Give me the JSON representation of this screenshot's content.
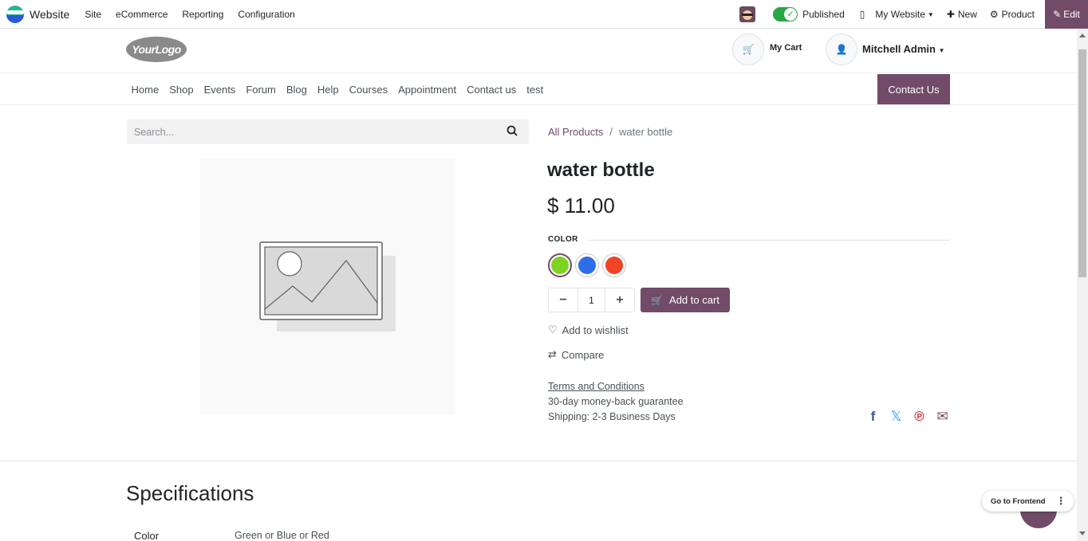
{
  "topbar": {
    "app_name": "Website",
    "menu": [
      "Site",
      "eCommerce",
      "Reporting",
      "Configuration"
    ],
    "published_label": "Published",
    "website_selector": "My Website",
    "new_label": "New",
    "product_label": "Product",
    "edit_label": "Edit"
  },
  "header": {
    "logo_text": "YourLogo",
    "cart_label": "My Cart",
    "user_name": "Mitchell Admin"
  },
  "nav": {
    "items": [
      "Home",
      "Shop",
      "Events",
      "Forum",
      "Blog",
      "Help",
      "Courses",
      "Appointment",
      "Contact us",
      "test"
    ],
    "contact_button": "Contact Us"
  },
  "search": {
    "placeholder": "Search..."
  },
  "breadcrumb": {
    "all_products": "All Products",
    "separator": "/",
    "current": "water bottle"
  },
  "product": {
    "name": "water bottle",
    "price": "$ 11.00",
    "attribute_label": "COLOR",
    "colors": [
      "#7ed321",
      "#2f6ee8",
      "#ef4425"
    ],
    "selected_color_index": 0,
    "quantity": "1",
    "add_to_cart": "Add to cart",
    "wishlist": "Add to wishlist",
    "compare": "Compare",
    "terms": "Terms and Conditions",
    "guarantee": "30-day money-back guarantee",
    "shipping": "Shipping: 2-3 Business Days"
  },
  "share": {
    "icons": [
      "facebook-icon",
      "x-twitter-icon",
      "pinterest-icon",
      "email-icon"
    ],
    "colors": {
      "facebook": "#3b5998",
      "x": "#1d9bf0",
      "pinterest": "#c8232c",
      "email": "#714b67"
    }
  },
  "specifications": {
    "title": "Specifications",
    "rows": [
      {
        "key": "Color",
        "value": "Green or Blue or Red"
      }
    ]
  },
  "frontend": {
    "label": "Go to Frontend"
  },
  "theme": {
    "primary": "#714b67",
    "toggle_on": "#28a745"
  }
}
